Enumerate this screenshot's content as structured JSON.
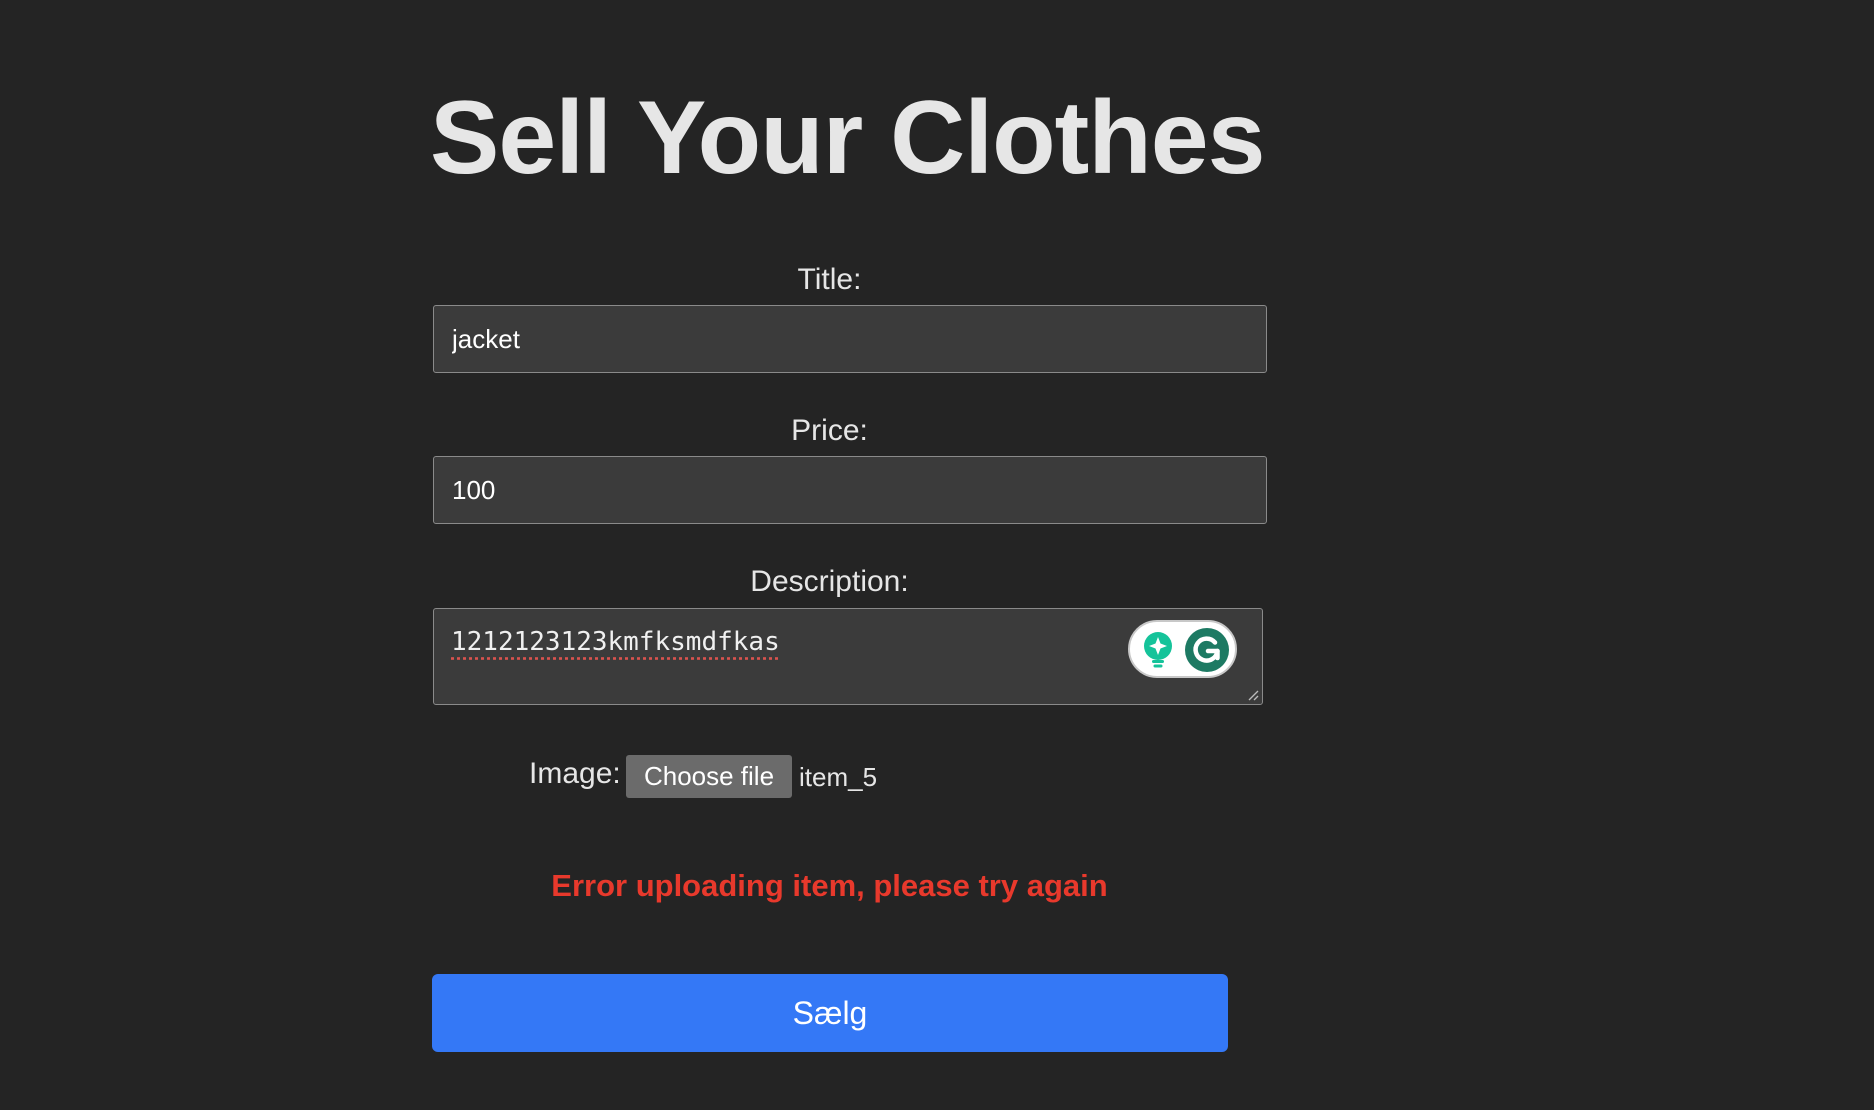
{
  "page": {
    "title": "Sell Your Clothes"
  },
  "form": {
    "title_label": "Title:",
    "title_value": "jacket",
    "price_label": "Price:",
    "price_value": "100",
    "description_label": "Description:",
    "description_value": "1212123123kmfksmdfkas",
    "image_label": "Image:",
    "choose_file_label": "Choose file",
    "file_name": "item_5",
    "error_message": "Error uploading item, please try again",
    "submit_label": "Sælg"
  },
  "colors": {
    "background": "#242424",
    "input_background": "#3b3b3b",
    "error": "#e8392c",
    "submit": "#3478f6",
    "grammarly_green": "#15c39a"
  },
  "icons": {
    "grammarly_assist": "grammarly-assistant-icon",
    "grammarly_logo": "grammarly-g-icon",
    "resize": "textarea-resize-handle"
  }
}
